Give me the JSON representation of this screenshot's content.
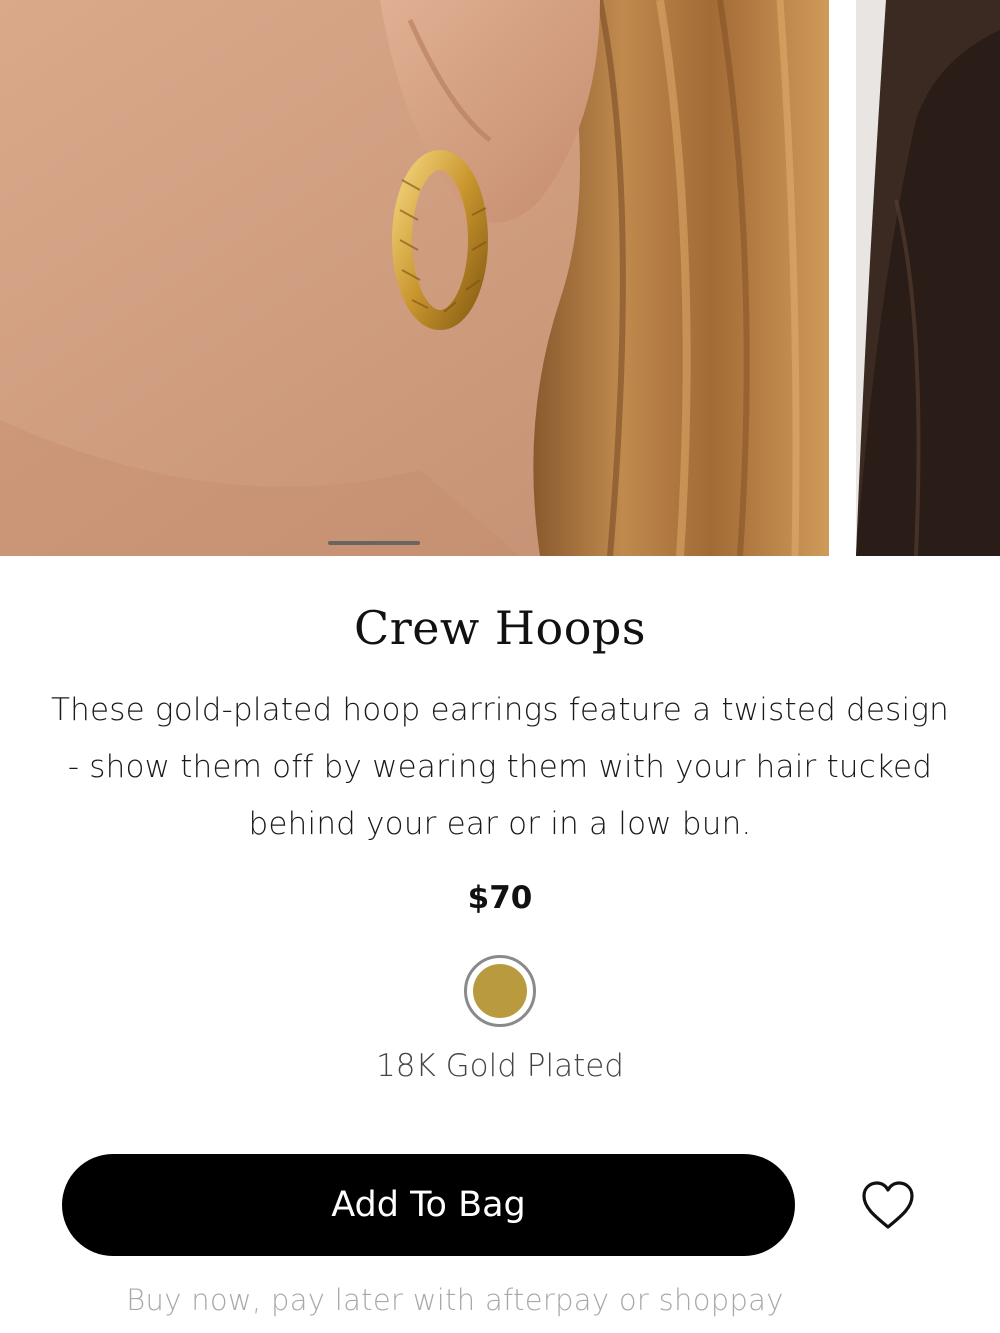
{
  "product": {
    "title": "Crew Hoops",
    "description": "These gold-plated hoop earrings feature a twisted design - show them off by wearing them with your hair tucked behind your ear or in a low bun.",
    "price": "$70",
    "variant": {
      "label": "18K Gold Plated",
      "swatch_color": "#b99a3e"
    }
  },
  "actions": {
    "add_to_bag_label": "Add To Bag",
    "wishlist_icon": "heart-icon"
  },
  "payment_note": "Buy now, pay later with afterpay or shoppay",
  "carousel": {
    "images": [
      "ear-with-gold-twisted-hoop",
      "model-dark-hair"
    ],
    "active_index": 0
  }
}
